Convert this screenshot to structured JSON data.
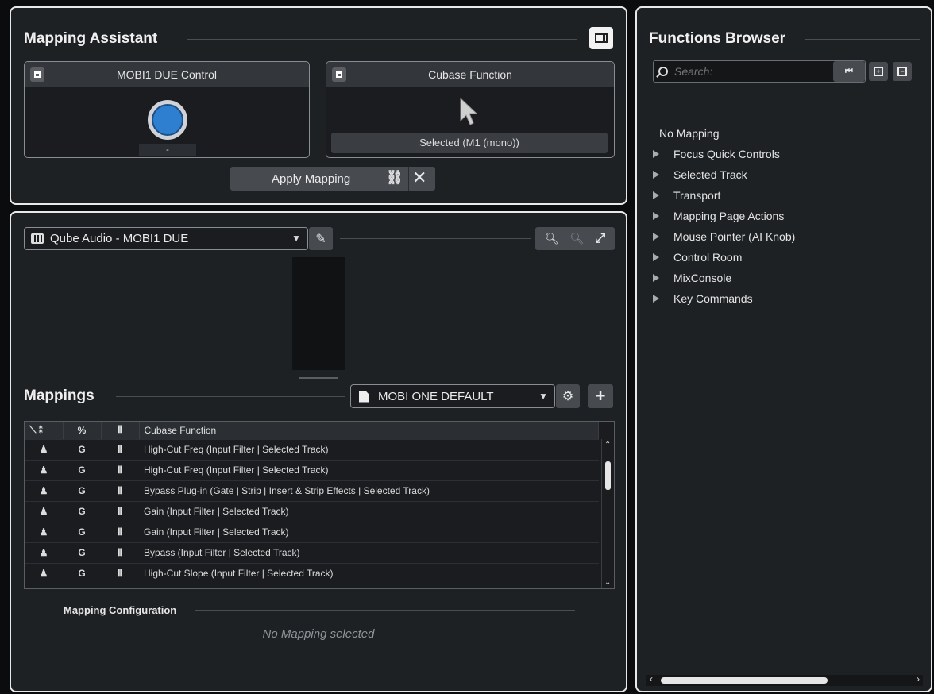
{
  "mapping_assistant": {
    "title": "Mapping Assistant",
    "control_box_title": "MOBI1 DUE Control",
    "control_value": "-",
    "function_box_title": "Cubase Function",
    "function_value": "Selected (M1 (mono))",
    "apply_label": "Apply Mapping"
  },
  "device": {
    "name": "Qube Audio - MOBI1 DUE"
  },
  "mappings": {
    "title": "Mappings",
    "page_name": "MOBI ONE DEFAULT",
    "columns": [
      "",
      "",
      "",
      "Cubase Function"
    ],
    "rows": [
      {
        "c1": "♟",
        "c2": "G",
        "c3": "⫴",
        "function": "High-Cut Freq (Input Filter | Selected Track)"
      },
      {
        "c1": "♟",
        "c2": "G",
        "c3": "⫴",
        "function": "High-Cut Freq (Input Filter | Selected Track)"
      },
      {
        "c1": "♟",
        "c2": "G",
        "c3": "⫴",
        "function": "Bypass Plug-in (Gate | Strip | Insert & Strip Effects | Selected Track)"
      },
      {
        "c1": "♟",
        "c2": "G",
        "c3": "⫴",
        "function": "Gain (Input Filter | Selected Track)"
      },
      {
        "c1": "♟",
        "c2": "G",
        "c3": "⫴",
        "function": "Gain (Input Filter | Selected Track)"
      },
      {
        "c1": "♟",
        "c2": "G",
        "c3": "⫴",
        "function": "Bypass (Input Filter | Selected Track)"
      },
      {
        "c1": "♟",
        "c2": "G",
        "c3": "⫴",
        "function": "High-Cut Slope (Input Filter | Selected Track)"
      }
    ],
    "config_title": "Mapping Configuration",
    "config_empty": "No Mapping selected"
  },
  "functions_browser": {
    "title": "Functions Browser",
    "search_placeholder": "Search:",
    "items": [
      {
        "label": "No Mapping",
        "expandable": false
      },
      {
        "label": "Focus Quick Controls",
        "expandable": true
      },
      {
        "label": "Selected Track",
        "expandable": true
      },
      {
        "label": "Transport",
        "expandable": true
      },
      {
        "label": "Mapping Page Actions",
        "expandable": true
      },
      {
        "label": "Mouse Pointer (AI Knob)",
        "expandable": true
      },
      {
        "label": "Control Room",
        "expandable": true
      },
      {
        "label": "MixConsole",
        "expandable": true
      },
      {
        "label": "Key Commands",
        "expandable": true
      }
    ]
  },
  "colors": {
    "panel_bg": "#1e2124",
    "knob_blue": "#2f7fd1",
    "accent_border": "#e8e8e8"
  }
}
